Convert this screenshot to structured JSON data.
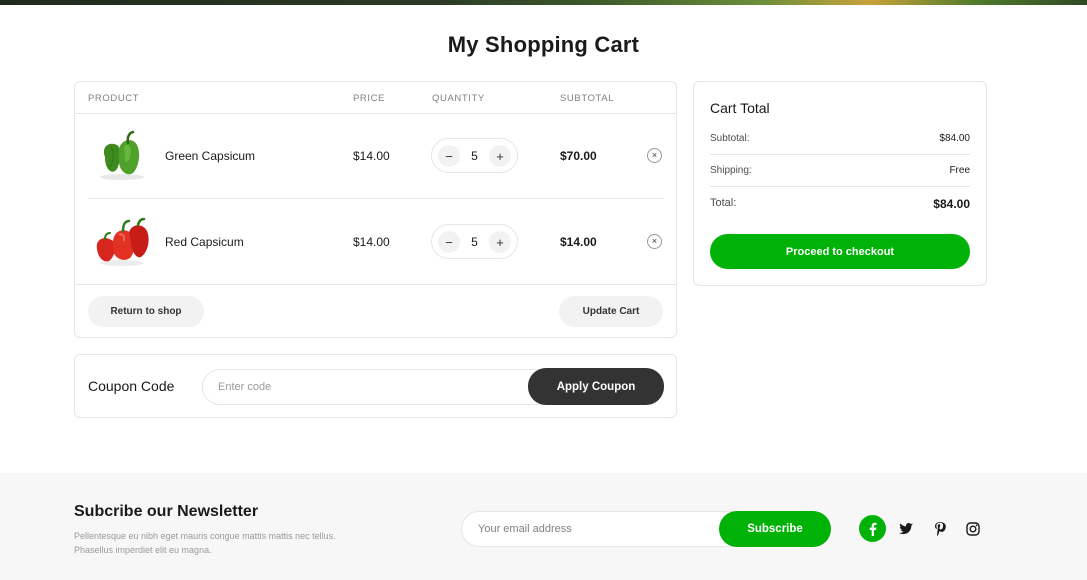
{
  "page": {
    "title": "My Shopping Cart"
  },
  "cart": {
    "headers": {
      "product": "PRODUCT",
      "price": "PRICE",
      "quantity": "QUANTITY",
      "subtotal": "SUBTOTAL"
    },
    "items": [
      {
        "name": "Green Capsicum",
        "price": "$14.00",
        "quantity": "5",
        "subtotal": "$70.00",
        "icon": "green-capsicum-image"
      },
      {
        "name": "Red Capsicum",
        "price": "$14.00",
        "quantity": "5",
        "subtotal": "$14.00",
        "icon": "red-capsicum-image"
      }
    ],
    "qty_minus": "−",
    "qty_plus": "+",
    "remove_symbol": "×",
    "return_label": "Return to shop",
    "update_label": "Update Cart"
  },
  "coupon": {
    "label": "Coupon Code",
    "placeholder": "Enter code",
    "button_label": "Apply Coupon"
  },
  "cart_total": {
    "title": "Cart Total",
    "subtotal_label": "Subtotal:",
    "subtotal_value": "$84.00",
    "shipping_label": "Shipping:",
    "shipping_value": "Free",
    "total_label": "Total:",
    "total_value": "$84.00",
    "checkout_label": "Proceed to checkout"
  },
  "newsletter": {
    "title": "Subcribe our Newsletter",
    "description": "Pellentesque eu nibh eget mauris congue mattis mattis nec tellus. Phasellus imperdiet elit eu magna.",
    "email_placeholder": "Your email address",
    "button_label": "Subscribe"
  },
  "social": [
    "facebook-icon",
    "twitter-icon",
    "pinterest-icon",
    "instagram-icon"
  ],
  "colors": {
    "brand_green": "#00b207",
    "dark_button": "#333333",
    "footer_bg": "#f7f7f7"
  }
}
